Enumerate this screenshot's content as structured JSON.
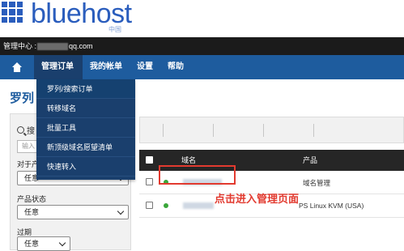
{
  "brand": {
    "logo_text": "bluehost",
    "logo_sub": "中国",
    "primary_color": "#2a5dbd"
  },
  "account_bar": {
    "prefix": "管理中心 :",
    "email_suffix": "qq.com"
  },
  "nav": {
    "home_icon": "home-icon",
    "items": [
      {
        "label": "管理订单"
      },
      {
        "label": "我的帐单"
      },
      {
        "label": "设置"
      },
      {
        "label": "帮助"
      }
    ]
  },
  "dropdown": {
    "items": [
      {
        "label": "罗列/搜索订单"
      },
      {
        "label": "转移域名"
      },
      {
        "label": "批量工具"
      },
      {
        "label": "新顶级域名愿望清单"
      },
      {
        "label": "快速转入"
      }
    ]
  },
  "page": {
    "title": "罗列"
  },
  "sidebar": {
    "search_label": "搜",
    "search_placeholder": "输入",
    "label_for_product": "对于产",
    "select_any": "任意",
    "label_product_status": "产品状态",
    "label_expired": "过期"
  },
  "table": {
    "columns": [
      "域名",
      "产品"
    ],
    "rows": [
      {
        "product": "域名管理"
      },
      {
        "product": "PS Linux KVM (USA)"
      }
    ]
  },
  "annotation": {
    "text": "点击进入管理页面",
    "color": "#e23a2f"
  }
}
